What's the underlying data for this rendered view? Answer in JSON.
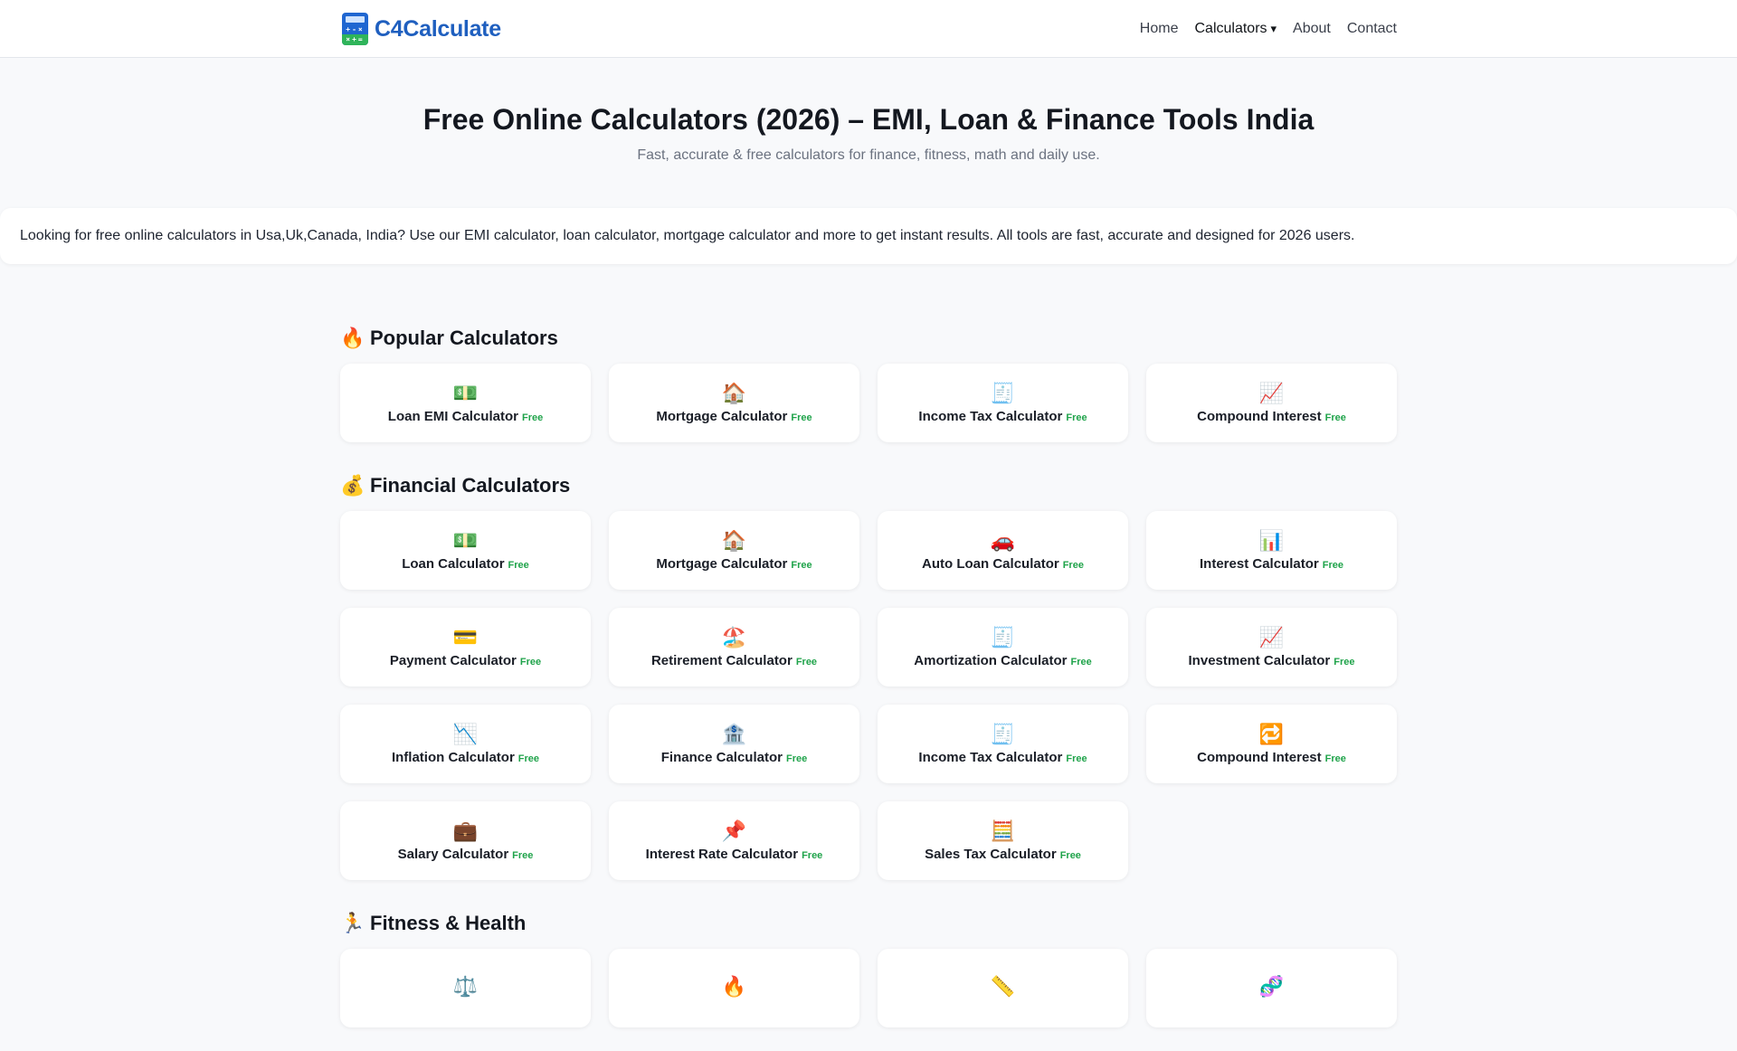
{
  "header": {
    "logo_text": "C4Calculate",
    "logo_keys_top": "+-×",
    "logo_keys_bottom": "×+=",
    "nav": {
      "home": "Home",
      "calculators": "Calculators",
      "calculators_caret": "▾",
      "about": "About",
      "contact": "Contact"
    }
  },
  "hero": {
    "title": "Free Online Calculators (2026) – EMI, Loan & Finance Tools India",
    "subtitle": "Fast, accurate & free calculators for finance, fitness, math and daily use."
  },
  "intro": {
    "text": "Looking for free online calculators in Usa,Uk,Canada, India? Use our EMI calculator, loan calculator, mortgage calculator and more to get instant results. All tools are fast, accurate and designed for 2026 users."
  },
  "badge": "Free",
  "sections": {
    "popular": {
      "emoji": "🔥",
      "title": "Popular Calculators",
      "items": [
        {
          "icon": "💵",
          "label": "Loan EMI Calculator"
        },
        {
          "icon": "🏠",
          "label": "Mortgage Calculator"
        },
        {
          "icon": "🧾",
          "label": "Income Tax Calculator"
        },
        {
          "icon": "📈",
          "label": "Compound Interest"
        }
      ]
    },
    "financial": {
      "emoji": "💰",
      "title": "Financial Calculators",
      "items": [
        {
          "icon": "💵",
          "label": "Loan Calculator"
        },
        {
          "icon": "🏠",
          "label": "Mortgage Calculator"
        },
        {
          "icon": "🚗",
          "label": "Auto Loan Calculator"
        },
        {
          "icon": "📊",
          "label": "Interest Calculator"
        },
        {
          "icon": "💳",
          "label": "Payment Calculator"
        },
        {
          "icon": "🏖️",
          "label": "Retirement Calculator"
        },
        {
          "icon": "🧾",
          "label": "Amortization Calculator"
        },
        {
          "icon": "📈",
          "label": "Investment Calculator"
        },
        {
          "icon": "📉",
          "label": "Inflation Calculator"
        },
        {
          "icon": "🏦",
          "label": "Finance Calculator"
        },
        {
          "icon": "🧾",
          "label": "Income Tax Calculator"
        },
        {
          "icon": "🔁",
          "label": "Compound Interest"
        },
        {
          "icon": "💼",
          "label": "Salary Calculator"
        },
        {
          "icon": "📌",
          "label": "Interest Rate Calculator"
        },
        {
          "icon": "🧮",
          "label": "Sales Tax Calculator"
        }
      ]
    },
    "fitness": {
      "emoji": "🏃",
      "title": "Fitness & Health",
      "items": [
        {
          "icon": "⚖️",
          "label": ""
        },
        {
          "icon": "🔥",
          "label": ""
        },
        {
          "icon": "📏",
          "label": ""
        },
        {
          "icon": "🧬",
          "label": ""
        }
      ]
    }
  }
}
